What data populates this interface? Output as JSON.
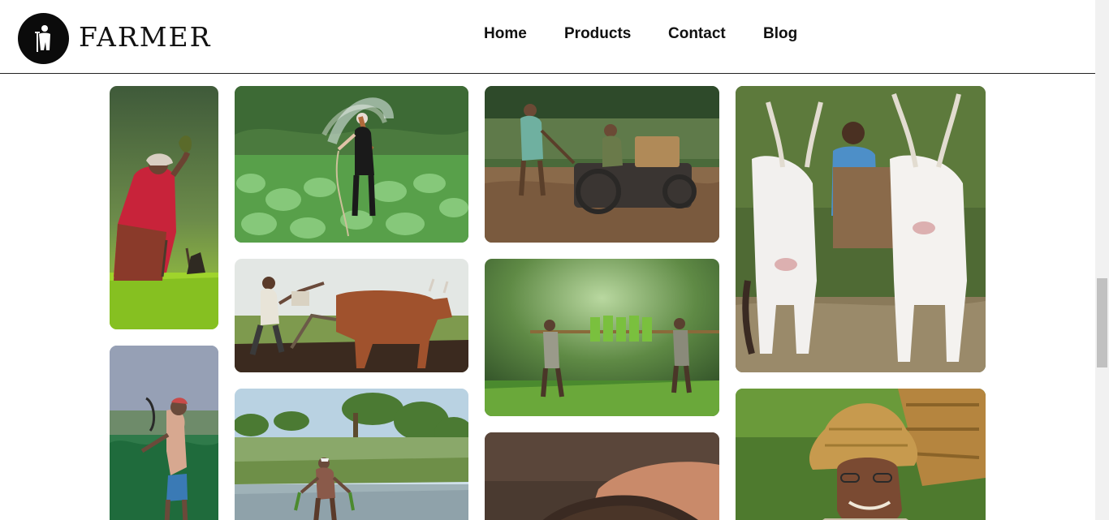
{
  "brand": {
    "name": "FARMER",
    "logo_icon": "farmer-silhouette-icon"
  },
  "nav": {
    "items": [
      {
        "label": "Home"
      },
      {
        "label": "Products"
      },
      {
        "label": "Contact"
      },
      {
        "label": "Blog"
      }
    ]
  },
  "gallery": {
    "photos": [
      {
        "subject": "woman-planting-rice-seedlings"
      },
      {
        "subject": "woman-watering-vegetable-field"
      },
      {
        "subject": "men-with-tiller-in-flooded-field"
      },
      {
        "subject": "farmer-on-bullock-cart"
      },
      {
        "subject": "farmer-with-sickle-in-leafy-field"
      },
      {
        "subject": "farmer-ploughing-with-ox"
      },
      {
        "subject": "two-farmers-carrying-rice-seedlings"
      },
      {
        "subject": "farmer-planting-in-paddy"
      },
      {
        "subject": "hand-holding-soil"
      },
      {
        "subject": "elderly-farmer-with-straw-hat"
      }
    ]
  }
}
